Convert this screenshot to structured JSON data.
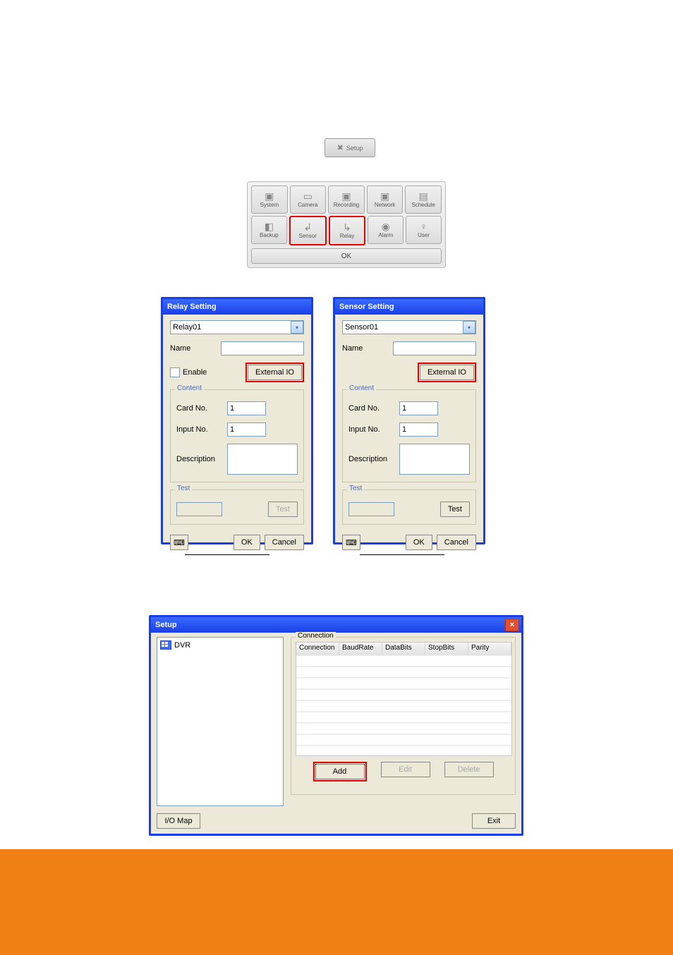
{
  "setup_small": {
    "label": "Setup"
  },
  "toolbar": {
    "row1": [
      {
        "label": "System",
        "icon": "▣"
      },
      {
        "label": "Camera",
        "icon": "▭"
      },
      {
        "label": "Recording",
        "icon": "▣"
      },
      {
        "label": "Network",
        "icon": "▣"
      },
      {
        "label": "Schedule",
        "icon": "▤"
      }
    ],
    "row2": [
      {
        "label": "Backup",
        "icon": "◧"
      },
      {
        "label": "Sensor",
        "icon": "↲",
        "highlight": true
      },
      {
        "label": "Relay",
        "icon": "↳",
        "highlight": true
      },
      {
        "label": "Alarm",
        "icon": "◉"
      },
      {
        "label": "User",
        "icon": "♀"
      }
    ],
    "ok": "OK"
  },
  "relay": {
    "title": "Relay Setting",
    "select_value": "Relay01",
    "name_label": "Name",
    "enable_label": "Enable",
    "external_btn": "External IO",
    "content_legend": "Content",
    "card_label": "Card No.",
    "card_value": "1",
    "input_label": "Input No.",
    "input_value": "1",
    "desc_label": "Description",
    "test_legend": "Test",
    "test_btn": "Test",
    "ok": "OK",
    "cancel": "Cancel"
  },
  "sensor": {
    "title": "Sensor Setting",
    "select_value": "Sensor01",
    "name_label": "Name",
    "external_btn": "External IO",
    "content_legend": "Content",
    "card_label": "Card No.",
    "card_value": "1",
    "input_label": "Input No.",
    "input_value": "1",
    "desc_label": "Description",
    "test_legend": "Test",
    "test_btn": "Test",
    "ok": "OK",
    "cancel": "Cancel"
  },
  "setup_big": {
    "title": "Setup",
    "tree_root": "DVR",
    "connection_legend": "Connection",
    "columns": [
      "Connection",
      "BaudRate",
      "DataBits",
      "StopBits",
      "Parity"
    ],
    "add": "Add",
    "edit": "Edit",
    "delete": "Delete",
    "iomap": "I/O Map",
    "exit": "Exit"
  }
}
